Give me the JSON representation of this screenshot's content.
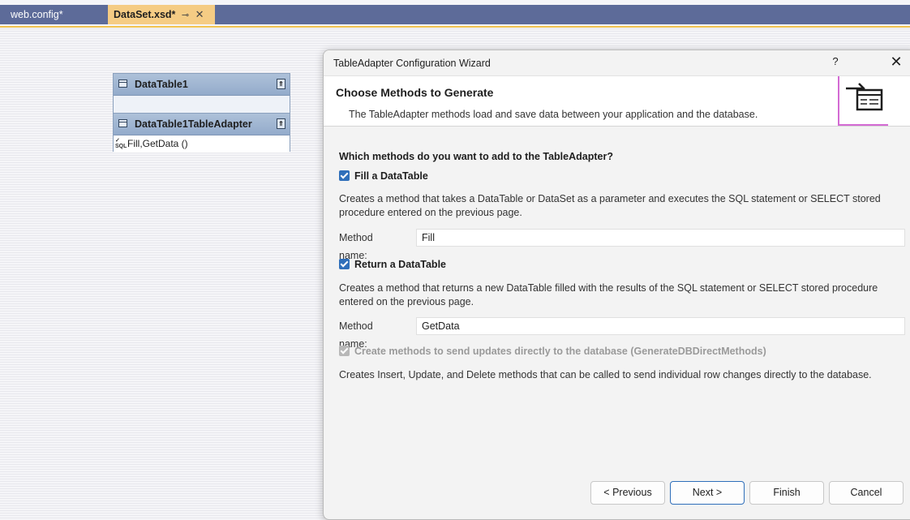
{
  "tabs": [
    {
      "label": "web.config*"
    },
    {
      "label": "DataSet.xsd*",
      "pin_icon": "pin-icon",
      "close_icon": "close-icon",
      "active": true
    }
  ],
  "designer": {
    "datatable": {
      "title": "DataTable1",
      "icon": "datatable-icon"
    },
    "adapter": {
      "title": "DataTable1TableAdapter",
      "icon": "tableadapter-icon",
      "query": "Fill,GetData ()",
      "query_icon": "sql-icon"
    }
  },
  "dialog": {
    "title": "TableAdapter Configuration Wizard",
    "help_label": "?",
    "close_label": "✕",
    "banner": {
      "heading": "Choose Methods to Generate",
      "subtitle": "The TableAdapter methods load and save data between your application and the database."
    },
    "question": "Which methods do you want to add to the TableAdapter?",
    "fill": {
      "label": "Fill a DataTable",
      "checked": true,
      "description": "Creates a method that takes a DataTable or DataSet as a parameter and executes the SQL statement or SELECT stored procedure entered on the previous page.",
      "method_label": "Method name:",
      "method_value": "Fill"
    },
    "return": {
      "label": "Return a DataTable",
      "checked": true,
      "description": "Creates a method that returns a new DataTable filled with the results of the SQL statement or SELECT stored procedure entered on the previous page.",
      "method_label": "Method name:",
      "method_value": "GetData"
    },
    "direct": {
      "label": "Create methods to send updates directly to the database (GenerateDBDirectMethods)",
      "checked": true,
      "disabled": true,
      "description": "Creates Insert, Update, and Delete methods that can be called to send individual row changes directly to the database."
    },
    "buttons": {
      "previous": "< Previous",
      "next": "Next >",
      "finish": "Finish",
      "cancel": "Cancel"
    }
  },
  "colors": {
    "tab_bar": "#5d6b99",
    "active_tab": "#f5cc84",
    "checkbox": "#2f6fba",
    "wizard_icon_accent": "#d36ad3"
  }
}
